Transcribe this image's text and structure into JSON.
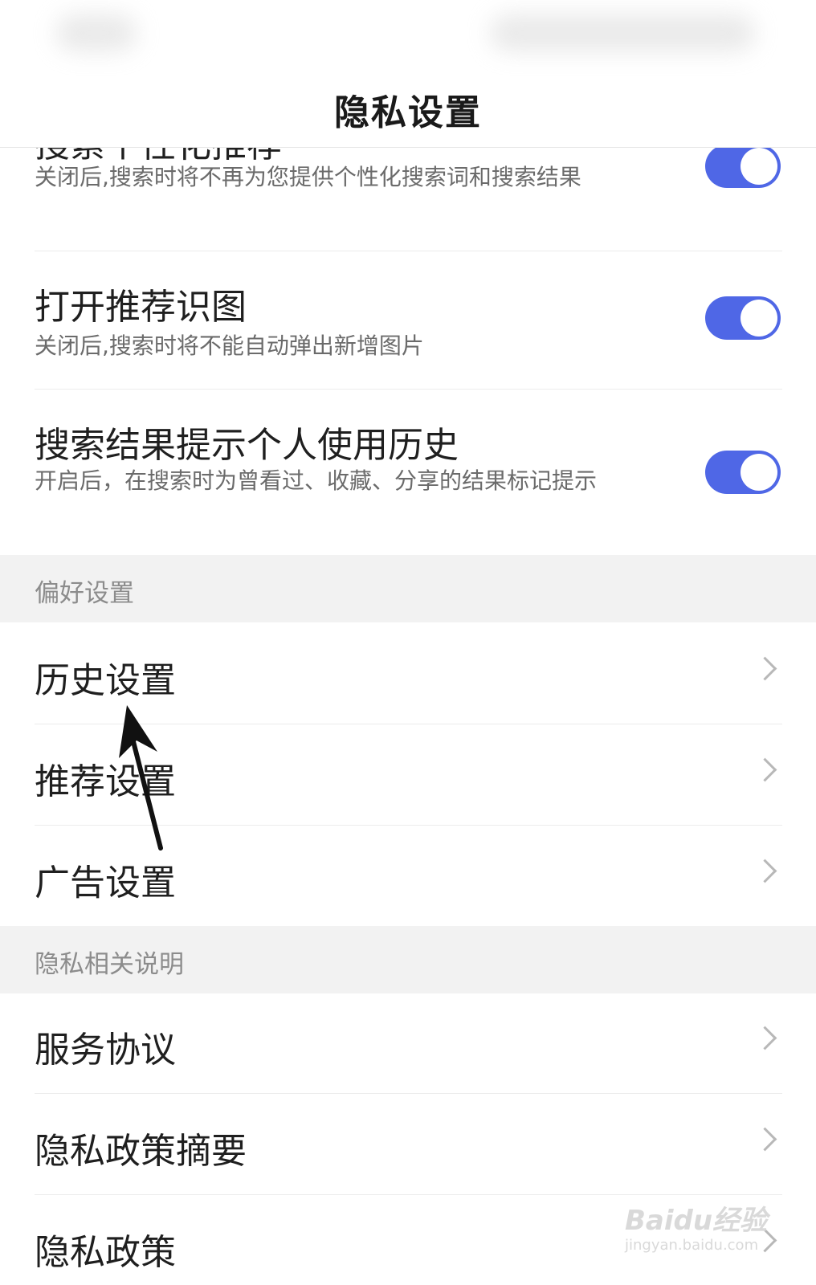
{
  "header": {
    "title": "隐私设置"
  },
  "toggles": [
    {
      "title": "搜索个性化推荐",
      "subtitle": "关闭后,搜索时将不再为您提供个性化搜索词和搜索结果",
      "on": true
    },
    {
      "title": "打开推荐识图",
      "subtitle": "关闭后,搜索时将不能自动弹出新增图片",
      "on": true
    },
    {
      "title": "搜索结果提示个人使用历史",
      "subtitle": "开启后，在搜索时为曾看过、收藏、分享的结果标记提示",
      "on": true
    }
  ],
  "sections": {
    "preferences": {
      "title": "偏好设置",
      "items": [
        {
          "label": "历史设置"
        },
        {
          "label": "推荐设置"
        },
        {
          "label": "广告设置"
        }
      ]
    },
    "privacy_info": {
      "title": "隐私相关说明",
      "items": [
        {
          "label": "服务协议"
        },
        {
          "label": "隐私政策摘要"
        },
        {
          "label": "隐私政策"
        }
      ]
    }
  },
  "colors": {
    "toggle_on": "#4f67e6",
    "section_bg": "#f2f2f2"
  },
  "icons": {
    "chevron": "chevron-right-icon",
    "annotation": "arrow-pointer-icon"
  },
  "watermark": {
    "brand": "Baidu经验",
    "url": "jingyan.baidu.com"
  }
}
